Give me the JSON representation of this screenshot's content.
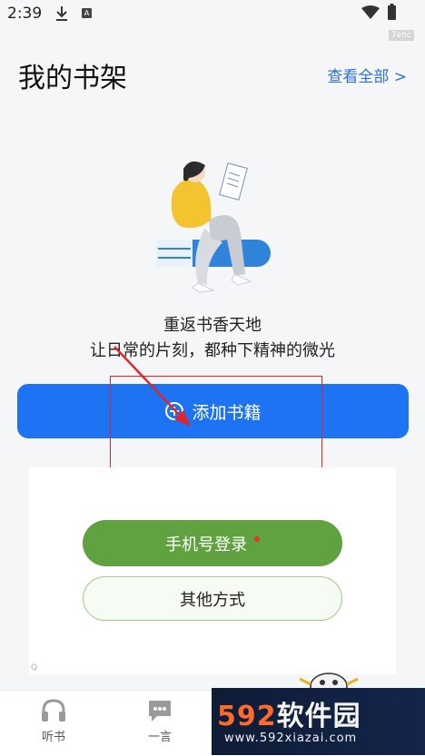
{
  "status_bar": {
    "time": "2:39",
    "download_icon": "download-icon",
    "notification_badge": "A",
    "wifi_icon": "wifi-icon",
    "battery_icon": "battery-icon"
  },
  "watermark_tag": "7ehc",
  "header": {
    "title": "我的书架",
    "view_all": "查看全部 >"
  },
  "empty_state": {
    "illustration": "girl-reading-books-illustration",
    "line1": "重返书香天地",
    "line2": "让日常的片刻，都种下精神的微光",
    "add_button": "添加书籍"
  },
  "login_card": {
    "phone_login": "手机号登录",
    "other_methods": "其他方式",
    "corner_mark": "Q"
  },
  "bottom_nav": {
    "items": [
      {
        "label": "听书",
        "icon": "headphones-icon"
      },
      {
        "label": "一言",
        "icon": "chat-bubble-icon"
      }
    ]
  },
  "brand_watermark": {
    "number": "592",
    "name": "软件园",
    "url": "www.592xiazai.com"
  },
  "colors": {
    "primary_blue": "#1e73f2",
    "login_green": "#5fa23f",
    "annotation_red": "#e0262c",
    "link_blue": "#2f6fd7"
  }
}
